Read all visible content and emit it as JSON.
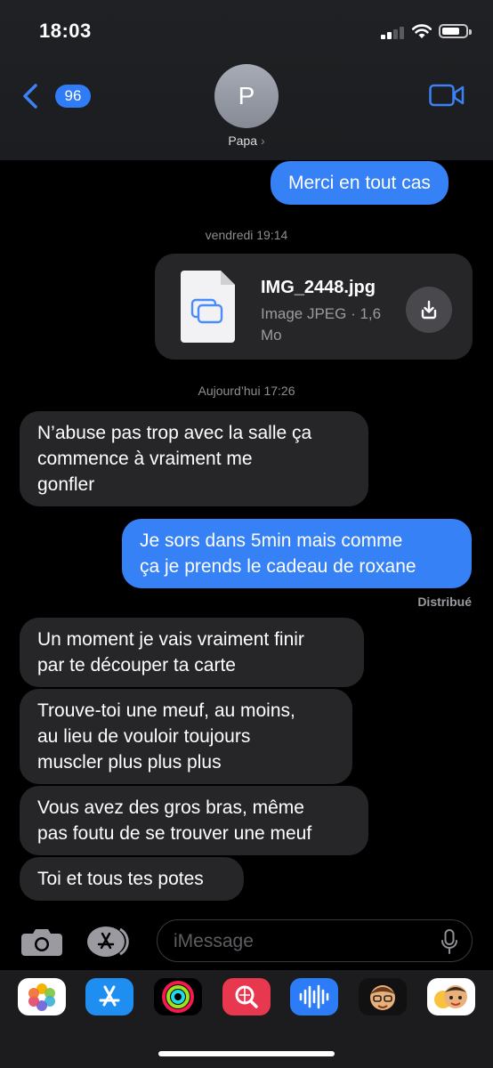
{
  "status": {
    "time": "18:03"
  },
  "header": {
    "back_badge": "96",
    "avatar_initial": "P",
    "contact_name": "Papa",
    "contact_arrow": "›"
  },
  "thread": {
    "msg1": "Merci en tout cas",
    "stamp1_day": "vendredi",
    "stamp1_time": "19:14",
    "attachment": {
      "name": "IMG_2448.jpg",
      "meta_line1": "Image JPEG · 1,6",
      "meta_line2": "Mo"
    },
    "stamp2_day": "Aujourd’hui",
    "stamp2_time": "17:26",
    "msg2": [
      "N’abuse pas trop avec la salle ça",
      "commence à vraiment me",
      "gonfler"
    ],
    "msg3": [
      "Je sors dans 5min mais comme",
      "ça je prends le cadeau de roxane"
    ],
    "delivered": "Distribué",
    "msg4": [
      "Un moment je vais vraiment finir",
      "par te découper ta carte"
    ],
    "msg5": [
      "Trouve-toi une meuf, au moins,",
      "au lieu de vouloir toujours",
      "muscler plus plus plus"
    ],
    "msg6": [
      "Vous avez des gros bras, même",
      "pas foutu de se trouver une meuf"
    ],
    "msg7": "Toi et tous tes potes"
  },
  "input": {
    "placeholder": "iMessage"
  },
  "app_drawer": [
    "photos-app",
    "app-store-app",
    "activity-app",
    "web-search-app",
    "audio-message-app",
    "memoji-app",
    "memoji-stickers-app"
  ],
  "colors": {
    "sent_bubble": "#3581f5",
    "received_bubble": "#262629",
    "accent": "#2f7cf6",
    "background": "#000000"
  }
}
